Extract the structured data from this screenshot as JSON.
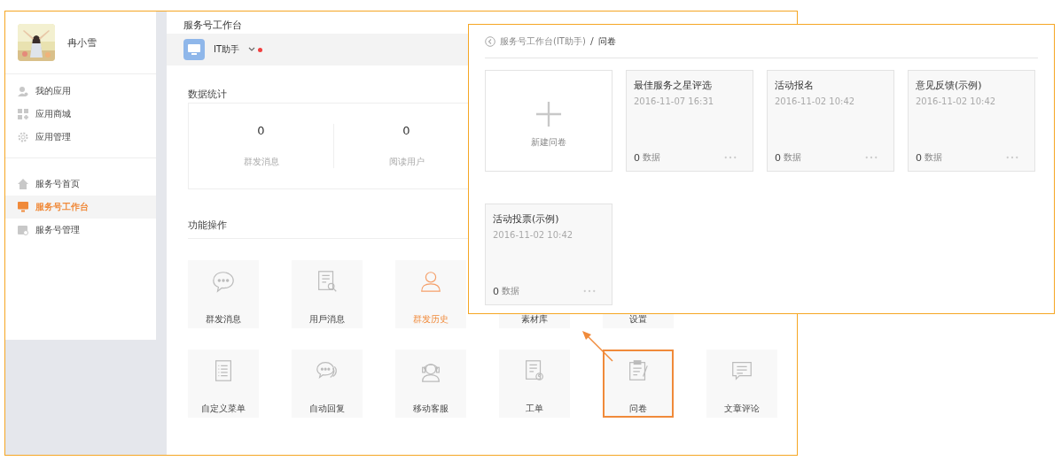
{
  "sidebar": {
    "user": {
      "name": "冉小雪"
    },
    "groups": [
      {
        "items": [
          {
            "label": "我的应用",
            "selected": false
          },
          {
            "label": "应用商城",
            "selected": false
          },
          {
            "label": "应用管理",
            "selected": false
          }
        ]
      },
      {
        "items": [
          {
            "label": "服务号首页",
            "selected": false
          },
          {
            "label": "服务号工作台",
            "selected": true
          },
          {
            "label": "服务号管理",
            "selected": false
          }
        ]
      }
    ]
  },
  "main": {
    "title": "服务号工作台",
    "account": {
      "name": "IT助手",
      "unread": true
    },
    "stats": {
      "title": "数据统计",
      "items": [
        {
          "value": "0",
          "label": "群发消息"
        },
        {
          "value": "0",
          "label": "阅读用户"
        }
      ]
    },
    "functions": {
      "title": "功能操作",
      "rows": [
        [
          {
            "label": "群发消息",
            "selected": false,
            "highlighted": false
          },
          {
            "label": "用戶消息",
            "selected": false,
            "highlighted": false
          },
          {
            "label": "群发历史",
            "selected": true,
            "highlighted": false
          },
          {
            "label": "素材库",
            "selected": false,
            "highlighted": false
          },
          {
            "label": "设置",
            "selected": false,
            "highlighted": false
          }
        ],
        [
          {
            "label": "自定义菜单",
            "selected": false,
            "highlighted": false
          },
          {
            "label": "自动回复",
            "selected": false,
            "highlighted": false
          },
          {
            "label": "移动客服",
            "selected": false,
            "highlighted": false
          },
          {
            "label": "工单",
            "selected": false,
            "highlighted": false
          },
          {
            "label": "问卷",
            "selected": false,
            "highlighted": true
          },
          {
            "label": "文章评论",
            "selected": false,
            "highlighted": false
          }
        ]
      ]
    }
  },
  "overlay": {
    "breadcrumb": {
      "parent": "服务号工作台(IT助手)",
      "separator": "/",
      "current": "问卷"
    },
    "new_card": {
      "label": "新建问卷"
    },
    "cards": [
      {
        "title": "最佳服务之星评选",
        "date": "2016-11-07 16:31",
        "count": "0",
        "unit": "数据"
      },
      {
        "title": "活动报名",
        "date": "2016-11-02 10:42",
        "count": "0",
        "unit": "数据"
      },
      {
        "title": "意见反馈(示例)",
        "date": "2016-11-02 10:42",
        "count": "0",
        "unit": "数据"
      },
      {
        "title": "活动投票(示例)",
        "date": "2016-11-02 10:42",
        "count": "0",
        "unit": "数据"
      }
    ]
  }
}
